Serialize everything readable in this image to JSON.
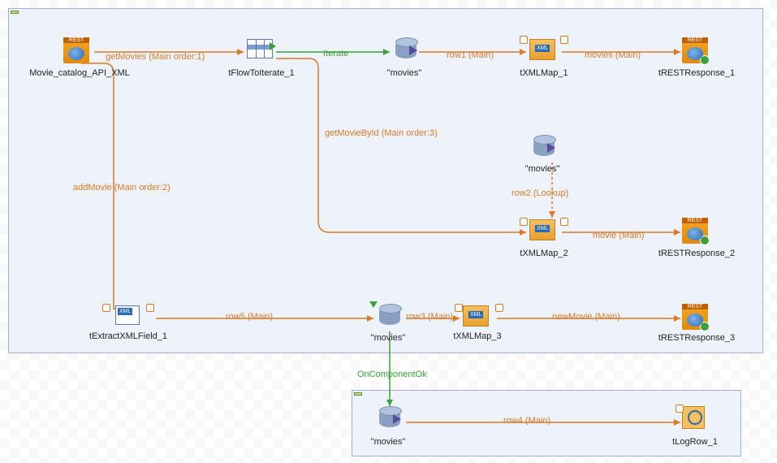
{
  "subjob1": {
    "components": {
      "c1": "Movie_catalog_API_XML",
      "c2": "tFlowToIterate_1",
      "c3": "\"movies\"",
      "c4": "tXMLMap_1",
      "c5": "tRESTResponse_1",
      "c6": "\"movies\"",
      "c7": "tXMLMap_2",
      "c8": "tRESTResponse_2",
      "c9": "tExtractXMLField_1",
      "c10": "\"movies\"",
      "c11": "tXMLMap_3",
      "c12": "tRESTResponse_3"
    },
    "connections": {
      "l1": "getMovies (Main order:1)",
      "l2": "Iterate",
      "l3": "row1 (Main)",
      "l4": "movies (Main)",
      "l5": "getMovieById (Main order:3)",
      "l6": "row2 (Lookup)",
      "l7": "movie (Main)",
      "l8": "addMovie (Main order:2)",
      "l9": "row5 (Main)",
      "l10": "row3 (Main)",
      "l11": "newMovie (Main)"
    }
  },
  "subjob2": {
    "components": {
      "c13": "\"movies\"",
      "c14": "tLogRow_1"
    },
    "connections": {
      "l12": "OnComponentOk",
      "l13": "row4 (Main)"
    }
  }
}
